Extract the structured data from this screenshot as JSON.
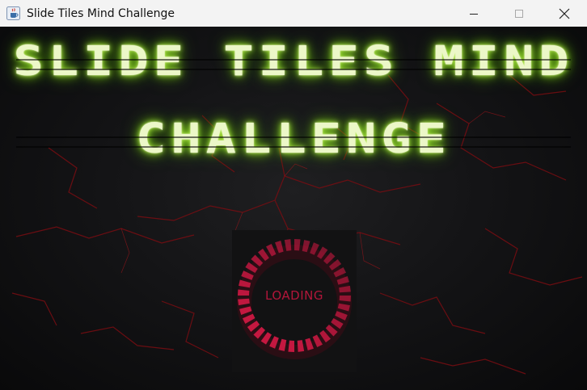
{
  "window": {
    "title": "Slide Tiles Mind Challenge",
    "icon": "java-cup-icon",
    "controls": [
      "minimize-icon",
      "maximize-icon",
      "close-icon"
    ]
  },
  "game": {
    "title_line1": "SLIDE TILES MIND",
    "title_line2": "CHALLENGE",
    "loading_text": "LOADING",
    "colors": {
      "title_glow": "#9be22d",
      "loader": "#c41840",
      "background": "#141416",
      "cracks": "#8a0f14"
    }
  }
}
